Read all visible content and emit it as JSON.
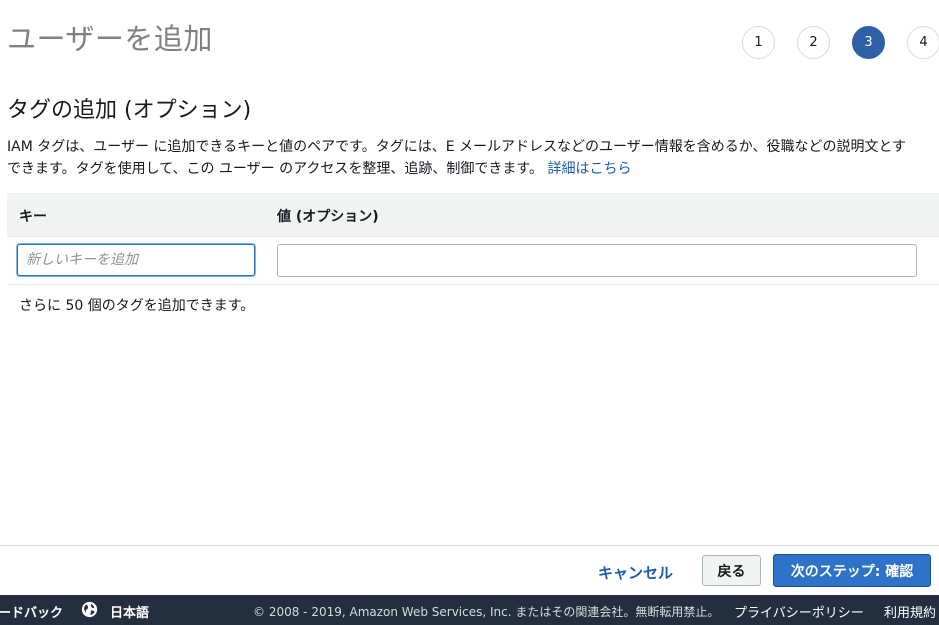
{
  "header": {
    "title": "ユーザーを追加",
    "steps": [
      "1",
      "2",
      "3",
      "4"
    ],
    "active_step": "3"
  },
  "section": {
    "title": "タグの追加 (オプション)",
    "description_line1": "IAM タグは、ユーザー に追加できるキーと値のペアです。タグには、E メールアドレスなどのユーザー情報を含めるか、役職などの説明文とす",
    "description_line2": "できます。タグを使用して、この ユーザー のアクセスを整理、追跡、制御できます。",
    "learn_more_link": "詳細はこちら"
  },
  "table": {
    "headers": {
      "key": "キー",
      "value": "値 (オプション)"
    },
    "key_placeholder": "新しいキーを追加",
    "key_value": "",
    "value_value": ""
  },
  "remaining_text": "さらに 50 個のタグを追加できます。",
  "actions": {
    "cancel": "キャンセル",
    "back": "戻る",
    "next": "次のステップ: 確認"
  },
  "console_footer": {
    "feedback": "ードバック",
    "language": "日本語",
    "copyright": "© 2008 - 2019, Amazon Web Services, Inc. またはその関連会社。無断転用禁止。",
    "privacy": "プライバシーポリシー",
    "terms": "利用規約"
  },
  "colors": {
    "accent": "#2e5fa8",
    "link": "#1f5aa6",
    "primary_button": "#2e73c8",
    "footer_bg": "#232f3e"
  }
}
